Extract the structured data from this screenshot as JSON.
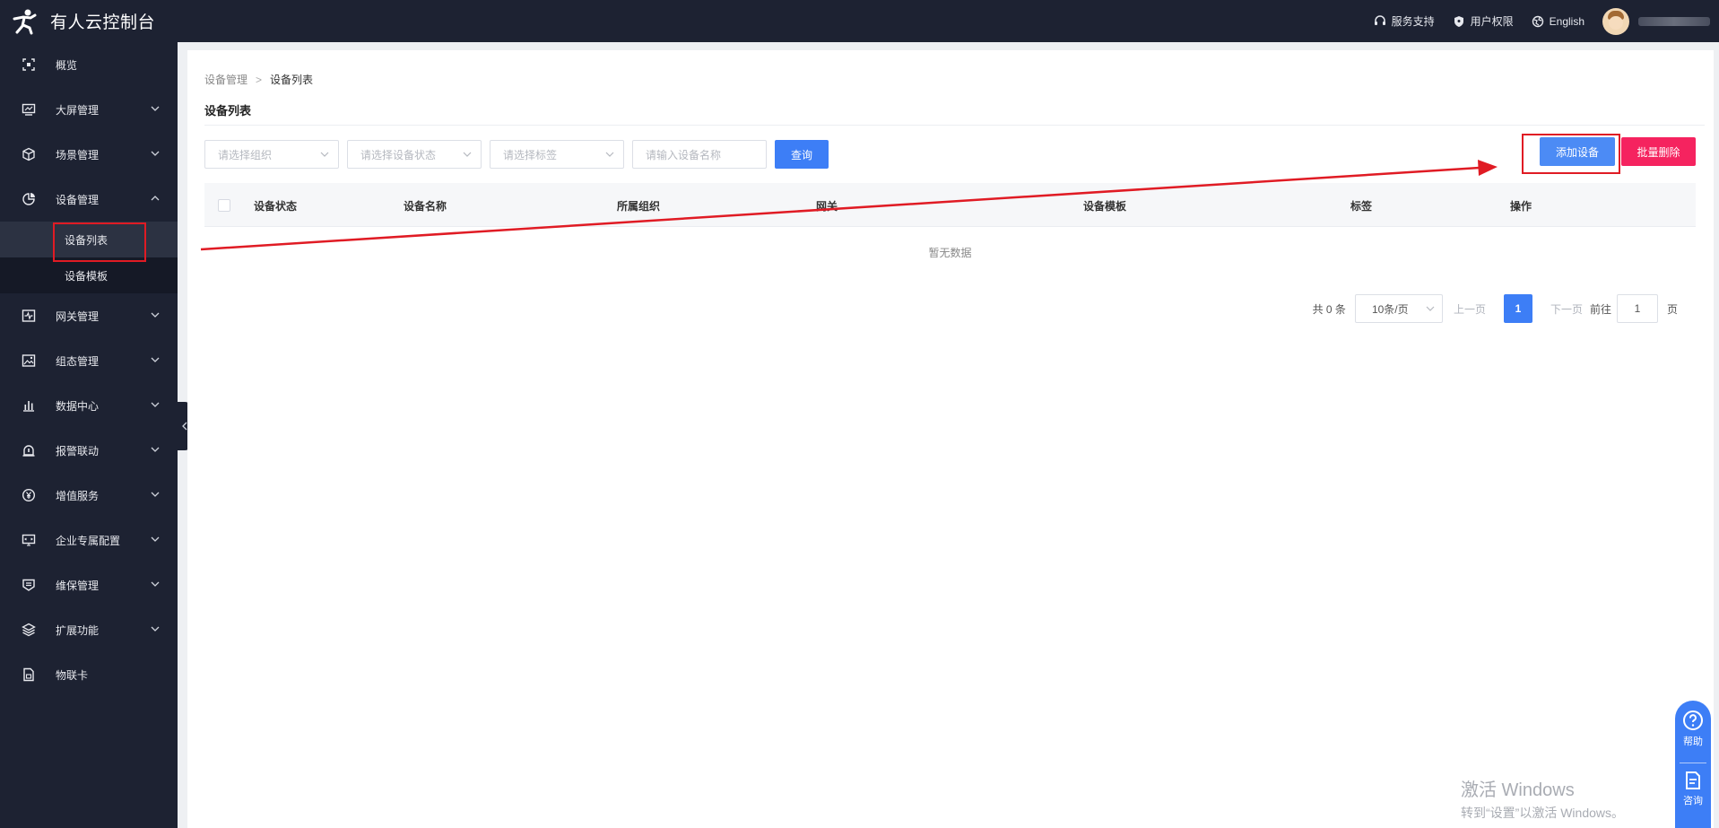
{
  "header": {
    "app_title": "有人云控制台",
    "support": "服务支持",
    "permissions": "用户权限",
    "language": "English"
  },
  "sidebar": {
    "items": [
      {
        "label": "概览",
        "icon": "overview-icon",
        "expandable": false
      },
      {
        "label": "大屏管理",
        "icon": "screen-icon",
        "expandable": true
      },
      {
        "label": "场景管理",
        "icon": "cube-icon",
        "expandable": true
      },
      {
        "label": "设备管理",
        "icon": "pie-chart-icon",
        "expandable": true,
        "expanded": true,
        "children": [
          {
            "label": "设备列表",
            "active": true
          },
          {
            "label": "设备模板",
            "active": false
          }
        ]
      },
      {
        "label": "网关管理",
        "icon": "gateway-icon",
        "expandable": true
      },
      {
        "label": "组态管理",
        "icon": "image-icon",
        "expandable": true
      },
      {
        "label": "数据中心",
        "icon": "bar-chart-icon",
        "expandable": true
      },
      {
        "label": "报警联动",
        "icon": "alarm-icon",
        "expandable": true
      },
      {
        "label": "增值服务",
        "icon": "yen-icon",
        "expandable": true
      },
      {
        "label": "企业专属配置",
        "icon": "monitor-icon",
        "expandable": true
      },
      {
        "label": "维保管理",
        "icon": "maintenance-icon",
        "expandable": true
      },
      {
        "label": "扩展功能",
        "icon": "layers-icon",
        "expandable": true
      },
      {
        "label": "物联卡",
        "icon": "sim-card-icon",
        "expandable": false
      }
    ]
  },
  "breadcrumb": {
    "parent": "设备管理",
    "separator": ">",
    "current": "设备列表"
  },
  "page": {
    "title": "设备列表"
  },
  "filters": {
    "org_placeholder": "请选择组织",
    "status_placeholder": "请选择设备状态",
    "tag_placeholder": "请选择标签",
    "name_placeholder": "请输入设备名称",
    "query_label": "查询"
  },
  "actions": {
    "add_label": "添加设备",
    "batch_delete_label": "批量删除"
  },
  "table": {
    "columns": [
      "设备状态",
      "设备名称",
      "所属组织",
      "网关",
      "设备模板",
      "标签",
      "操作"
    ],
    "empty_text": "暂无数据"
  },
  "pagination": {
    "total": "共 0 条",
    "page_size": "10条/页",
    "prev": "上一页",
    "current_page": "1",
    "next": "下一页",
    "goto": "前往",
    "goto_value": "1",
    "page_suffix": "页"
  },
  "float_panel": {
    "help": "帮助",
    "consult": "咨询"
  },
  "watermark": {
    "line1": "激活 Windows",
    "line2": "转到“设置”以激活 Windows。"
  },
  "colors": {
    "topbar": "#1d2232",
    "primary": "#3d7ef6",
    "danger": "#f5235f",
    "annotation": "#e01b24"
  }
}
